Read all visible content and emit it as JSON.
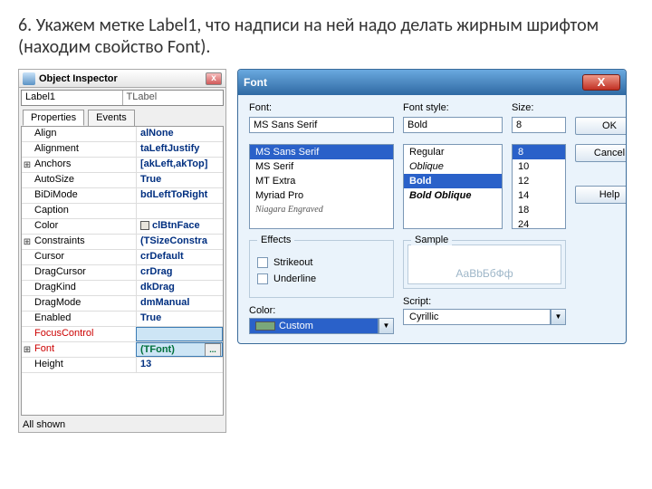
{
  "instruction": "6. Укажем метке Label1, что надписи на ней надо делать жирным шрифтом (находим свойство Font).",
  "oi": {
    "title": "Object Inspector",
    "closeX": "x",
    "combo": {
      "name": "Label1",
      "class": "TLabel"
    },
    "tabs": {
      "properties": "Properties",
      "events": "Events"
    },
    "rows": {
      "align": {
        "label": "Align",
        "value": "alNone"
      },
      "alignment": {
        "label": "Alignment",
        "value": "taLeftJustify"
      },
      "anchors": {
        "label": "Anchors",
        "value": "[akLeft,akTop]"
      },
      "autosize": {
        "label": "AutoSize",
        "value": "True"
      },
      "bidi": {
        "label": "BiDiMode",
        "value": "bdLeftToRight"
      },
      "caption": {
        "label": "Caption",
        "value": ""
      },
      "color": {
        "label": "Color",
        "value": "clBtnFace"
      },
      "constraints": {
        "label": "Constraints",
        "value": "(TSizeConstra"
      },
      "cursor": {
        "label": "Cursor",
        "value": "crDefault"
      },
      "dragcursor": {
        "label": "DragCursor",
        "value": "crDrag"
      },
      "dragkind": {
        "label": "DragKind",
        "value": "dkDrag"
      },
      "dragmode": {
        "label": "DragMode",
        "value": "dmManual"
      },
      "enabled": {
        "label": "Enabled",
        "value": "True"
      },
      "focusctl": {
        "label": "FocusControl",
        "value": ""
      },
      "font": {
        "label": "Font",
        "value": "(TFont)"
      },
      "height": {
        "label": "Height",
        "value": "13"
      }
    },
    "dots": "...",
    "footer": "All shown"
  },
  "fd": {
    "title": "Font",
    "closeX": "X",
    "labels": {
      "font": "Font:",
      "style": "Font style:",
      "size": "Size:",
      "effects": "Effects",
      "sample": "Sample",
      "strike": "Strikeout",
      "under": "Underline",
      "color": "Color:",
      "script": "Script:"
    },
    "font_value": "MS Sans Serif",
    "style_value": "Bold",
    "size_value": "8",
    "font_list": {
      "a": "MS Sans Serif",
      "b": "MS Serif",
      "c": "MT Extra",
      "d": "Myriad Pro",
      "e": "Niagara Engraved"
    },
    "style_list": {
      "a": "Regular",
      "b": "Oblique",
      "c": "Bold",
      "d": "Bold Oblique"
    },
    "size_list": {
      "a": "8",
      "b": "10",
      "c": "12",
      "d": "14",
      "e": "18",
      "f": "24"
    },
    "buttons": {
      "ok": "OK",
      "cancel": "Cancel",
      "help": "Help"
    },
    "color_value": "Custom",
    "script_value": "Cyrillic",
    "sample_text": "АаВbБбФф"
  }
}
